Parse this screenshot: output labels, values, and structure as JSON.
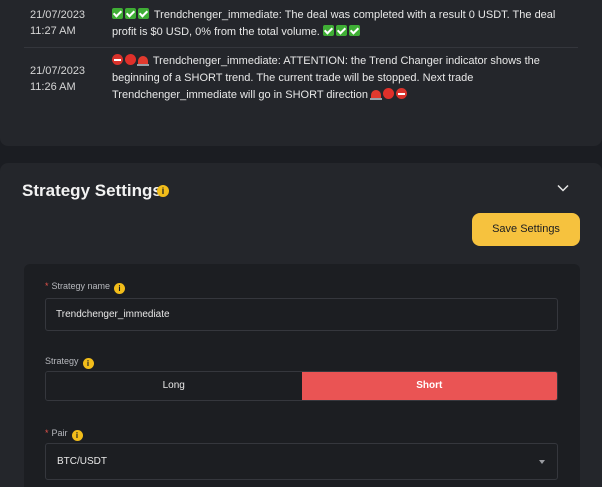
{
  "log": {
    "entries": [
      {
        "date": "21/07/2023",
        "time": "11:27 AM",
        "message": "Trendchenger_immediate: The deal was completed with a result 0 USDT. The deal profit is $0 USD, 0% from the total volume."
      },
      {
        "date": "21/07/2023",
        "time": "11:26 AM",
        "message": "Trendchenger_immediate: ATTENTION: the Trend Changer indicator shows the beginning of a SHORT trend. The current trade will be stopped. Next trade Trendchenger_immediate will go in SHORT direction"
      }
    ]
  },
  "settings": {
    "title": "Strategy Settings",
    "save_label": "Save Settings",
    "fields": {
      "name_label": "Strategy name",
      "name_value": "Trendchenger_immediate",
      "strategy_label": "Strategy",
      "strategy_options": [
        "Long",
        "Short"
      ],
      "strategy_selected": "Short",
      "pair_label": "Pair",
      "pair_value": "BTC/USDT"
    }
  },
  "colors": {
    "accent": "#f6c23e",
    "short_active": "#ea5454",
    "background": "#1b1d22",
    "panel": "#24262b"
  }
}
